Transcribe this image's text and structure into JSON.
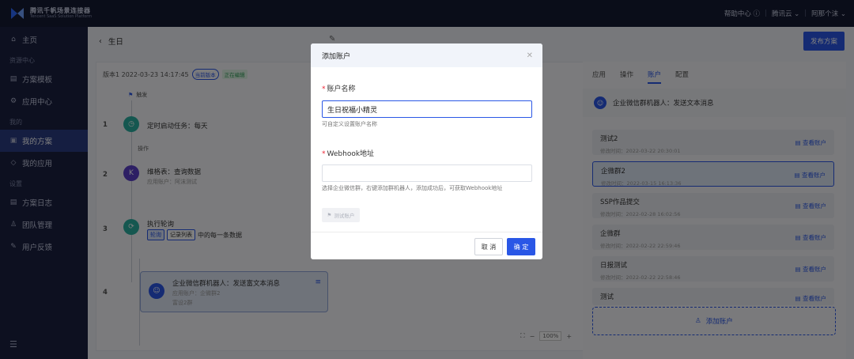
{
  "topbar": {
    "logo_line1": "腾讯千帆场景连接器",
    "logo_line2": "Tencent SaaS Solution Platform",
    "help": "帮助中心",
    "cloud": "腾讯云",
    "user": "阿那个沫"
  },
  "sidebar": {
    "home": "主页",
    "group_resources": "资源中心",
    "templates": "方案模板",
    "app_center": "应用中心",
    "group_mine": "我的",
    "my_solutions": "我的方案",
    "my_apps": "我的应用",
    "group_settings": "设置",
    "solution_log": "方案日志",
    "team": "团队管理",
    "feedback": "用户反馈"
  },
  "header": {
    "title": "生日",
    "publish": "发布方案"
  },
  "canvas": {
    "version_text": "版本1  2022-03-23 14:17:45",
    "badge_current": "当前版本",
    "badge_editing": "正在编辑",
    "trigger": "触发",
    "step1_no": "1",
    "step1_title": "定时启动任务：每天",
    "op_label": "操作",
    "step2_no": "2",
    "step2_title": "维格表：查询数据",
    "step2_sub": "应用账户：阿沫测试",
    "step3_no": "3",
    "step3_title": "执行轮询",
    "step3_tag1": "轮询",
    "step3_tag2": "记录列表",
    "step3_suffix": "中的每一条数据",
    "step4_no": "4",
    "step4_title": "企业微信群机器人：发送富文本消息",
    "step4_sub": "应用账户：企微群2",
    "step4_sub2": "富设2群",
    "zoom": "100%"
  },
  "right_panel": {
    "tabs": [
      "应用",
      "操作",
      "账户",
      "配置"
    ],
    "header": "企业微信群机器人：发送文本消息",
    "accounts": [
      {
        "name": "测试2",
        "time": "修改时间：2022-03-22 20:30:01",
        "view": "查看账户"
      },
      {
        "name": "企微群2",
        "time": "修改时间：2022-03-15 16:13:36",
        "view": "查看账户"
      },
      {
        "name": "SSP作品提交",
        "time": "修改时间：2022-02-28 16:02:56",
        "view": "查看账户"
      },
      {
        "name": "企微群",
        "time": "修改时间：2022-02-22 22:59:46",
        "view": "查看账户"
      },
      {
        "name": "日报测试",
        "time": "修改时间：2022-02-22 22:58:46",
        "view": "查看账户"
      },
      {
        "name": "测试",
        "time": "",
        "view": "查看账户"
      }
    ],
    "add_account": "添加账户"
  },
  "modal": {
    "title": "添加账户",
    "name_label": "账户名称",
    "name_value": "生日祝福小精灵",
    "name_hint": "可自定义设置账户名称",
    "webhook_label": "Webhook地址",
    "webhook_value": "",
    "webhook_hint": "选择企业微信群，右键添加群机器人，添加成功后，可获取Webhook地址",
    "test_btn": "测试账户",
    "cancel": "取 消",
    "ok": "确 定"
  }
}
